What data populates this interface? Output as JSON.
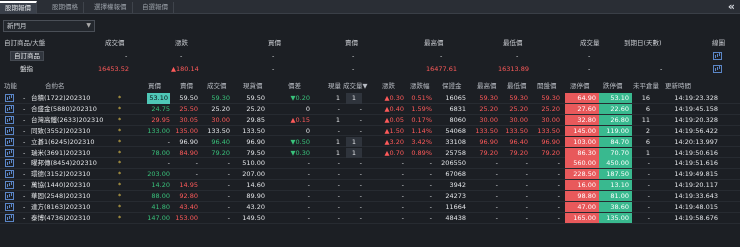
{
  "tabs": [
    "股期報價",
    "股期價格",
    "選擇權報價",
    "自選報價"
  ],
  "dropdown": "新門月",
  "summary": {
    "headers": [
      "自訂商品/大盤",
      "成交價",
      "漲跌",
      "買價",
      "賣價",
      "最高價",
      "最低價",
      "成交量",
      "到期日(天數)",
      "線圖"
    ],
    "rows": [
      {
        "name": "自訂商品",
        "price": "-",
        "chg": "-",
        "bid": "-",
        "ask": "-",
        "high": "-",
        "low": "-",
        "vol": "-",
        "exp": ""
      },
      {
        "name": "盤指",
        "price": "16453.52",
        "chg": "▲180.14",
        "bid": "-",
        "ask": "-",
        "high": "16477.61",
        "low": "16313.89",
        "vol": "-",
        "exp": "-"
      }
    ]
  },
  "grid": {
    "headers": [
      "功能",
      "合約名",
      "買價",
      "賣價",
      "成交價",
      "現貨價",
      "價差",
      "現量",
      "成交量▼",
      "漲跌",
      "漲跌幅",
      "保證金",
      "最高價",
      "最低價",
      "開盤價",
      "漲停價",
      "跌停價",
      "未平倉量",
      "更新時間"
    ],
    "rows": [
      {
        "name": "台積(1722)202310",
        "star": "*",
        "bid": "53.10",
        "ask": "59.50",
        "last": "59.30",
        "spot": "59.50",
        "spread": "▼0.20",
        "cur": "1",
        "vol": "1",
        "chg": "▲0.30",
        "pct": "0.51%",
        "margin": "16065",
        "high": "59.30",
        "low": "59.30",
        "open": "59.30",
        "up": "64.90",
        "dn": "53.10",
        "oi": "16",
        "time": "14:19:23.328"
      },
      {
        "name": "合盛金(5880)202310",
        "star": "*",
        "bid": "24.75",
        "ask": "25.50",
        "last": "25.20",
        "spot": "25.20",
        "spread": "0",
        "cur": "-",
        "vol": "-",
        "chg": "▲0.40",
        "pct": "1.59%",
        "margin": "6831",
        "high": "25.20",
        "low": "25.20",
        "open": "25.20",
        "up": "27.60",
        "dn": "22.60",
        "oi": "6",
        "time": "14:19:45.158"
      },
      {
        "name": "台灣高鐵(2633)202310",
        "star": "*",
        "bid": "29.95",
        "ask": "30.05",
        "last": "30.00",
        "spot": "29.85",
        "spread": "▲0.15",
        "cur": "1",
        "vol": "-",
        "chg": "▲0.05",
        "pct": "0.17%",
        "margin": "8060",
        "high": "30.00",
        "low": "30.00",
        "open": "30.00",
        "up": "32.80",
        "dn": "26.80",
        "oi": "11",
        "time": "14:19:20.328"
      },
      {
        "name": "同致(3552)202310",
        "star": "*",
        "bid": "133.00",
        "ask": "135.00",
        "last": "133.50",
        "spot": "133.50",
        "spread": "0",
        "cur": "-",
        "vol": "-",
        "chg": "▲1.50",
        "pct": "1.14%",
        "margin": "54068",
        "high": "133.50",
        "low": "133.50",
        "open": "133.50",
        "up": "145.00",
        "dn": "119.00",
        "oi": "2",
        "time": "14:19:56.422"
      },
      {
        "name": "立碁1(6245)202310",
        "star": "*",
        "bid": "-",
        "ask": "96.90",
        "last": "96.40",
        "spot": "96.90",
        "spread": "▼0.50",
        "cur": "1",
        "vol": "1",
        "chg": "▲3.20",
        "pct": "3.42%",
        "margin": "33108",
        "high": "96.90",
        "low": "96.40",
        "open": "96.90",
        "up": "103.00",
        "dn": "84.70",
        "oi": "6",
        "time": "14:20:13.997"
      },
      {
        "name": "瑞米(3691)202310",
        "star": "*",
        "bid": "78.00",
        "ask": "84.90",
        "last": "79.20",
        "spot": "79.50",
        "spread": "▼0.30",
        "cur": "1",
        "vol": "1",
        "chg": "▲0.70",
        "pct": "0.89%",
        "margin": "25758",
        "high": "79.20",
        "low": "79.20",
        "open": "79.20",
        "up": "86.30",
        "dn": "70.70",
        "oi": "1",
        "time": "14:19:50.616"
      },
      {
        "name": "曜邦傳(8454)202310",
        "star": "*",
        "bid": "-",
        "ask": "-",
        "last": "-",
        "spot": "510.00",
        "spread": "-",
        "cur": "-",
        "vol": "-",
        "chg": "-",
        "pct": "-",
        "margin": "206550",
        "high": "-",
        "low": "-",
        "open": "-",
        "up": "560.00",
        "dn": "450.00",
        "oi": "-",
        "time": "14:19:51.616"
      },
      {
        "name": "環德(3152)202310",
        "star": "*",
        "bid": "203.00",
        "ask": "-",
        "last": "-",
        "spot": "207.00",
        "spread": "-",
        "cur": "-",
        "vol": "-",
        "chg": "-",
        "pct": "-",
        "margin": "67068",
        "high": "-",
        "low": "-",
        "open": "-",
        "up": "228.50",
        "dn": "187.50",
        "oi": "-",
        "time": "14:19:49.815"
      },
      {
        "name": "萬協(1440)202310",
        "star": "*",
        "bid": "14.20",
        "ask": "14.95",
        "last": "-",
        "spot": "14.60",
        "spread": "-",
        "cur": "-",
        "vol": "-",
        "chg": "-",
        "pct": "-",
        "margin": "3942",
        "high": "-",
        "low": "-",
        "open": "-",
        "up": "16.00",
        "dn": "13.10",
        "oi": "-",
        "time": "14:19:20.117"
      },
      {
        "name": "華固(2548)202310",
        "star": "*",
        "bid": "88.00",
        "ask": "92.80",
        "last": "-",
        "spot": "89.90",
        "spread": "-",
        "cur": "-",
        "vol": "-",
        "chg": "-",
        "pct": "-",
        "margin": "24273",
        "high": "-",
        "low": "-",
        "open": "-",
        "up": "98.80",
        "dn": "81.00",
        "oi": "-",
        "time": "14:19:33.643"
      },
      {
        "name": "達方(8163)202310",
        "star": "*",
        "bid": "41.80",
        "ask": "43.40",
        "last": "-",
        "spot": "43.20",
        "spread": "-",
        "cur": "-",
        "vol": "-",
        "chg": "-",
        "pct": "-",
        "margin": "11664",
        "high": "-",
        "low": "-",
        "open": "-",
        "up": "47.00",
        "dn": "38.60",
        "oi": "-",
        "time": "14:19:48.015"
      },
      {
        "name": "泰博(4736)202310",
        "star": "*",
        "bid": "147.00",
        "ask": "153.00",
        "last": "-",
        "spot": "149.50",
        "spread": "-",
        "cur": "-",
        "vol": "-",
        "chg": "-",
        "pct": "-",
        "margin": "48438",
        "high": "-",
        "low": "-",
        "open": "-",
        "up": "165.00",
        "dn": "135.00",
        "oi": "-",
        "time": "14:19:58.676"
      }
    ]
  },
  "colors": {
    "limit_up_bg": "#e8595b",
    "limit_down_bg": "#39b98f",
    "highlight": "#4fc7b7"
  }
}
